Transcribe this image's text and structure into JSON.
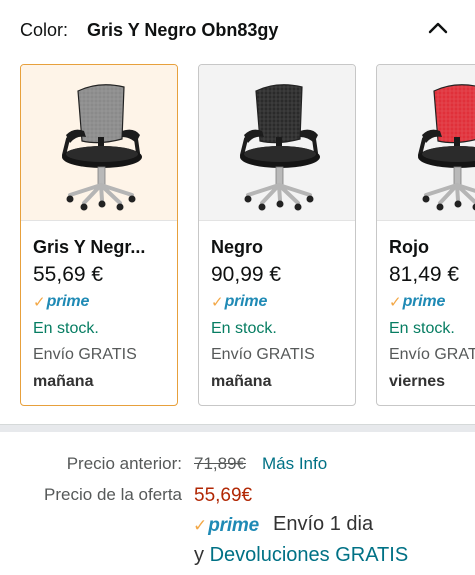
{
  "color_selector": {
    "label": "Color:",
    "selected_value": "Gris Y Negro Obn83gy",
    "collapse_icon": "chevron-up-icon"
  },
  "swatches": [
    {
      "name": "Gris Y Negr...",
      "price": "55,69 €",
      "prime": "prime",
      "stock": "En stock.",
      "shipping": "Envío GRATIS",
      "delivery_day": "mañana",
      "chair_color": "#8a8a8a",
      "selected": true
    },
    {
      "name": "Negro",
      "price": "90,99 €",
      "prime": "prime",
      "stock": "En stock.",
      "shipping": "Envío GRATIS",
      "delivery_day": "mañana",
      "chair_color": "#2a2a2a",
      "selected": false
    },
    {
      "name": "Rojo",
      "price": "81,49 €",
      "prime": "prime",
      "stock": "En stock.",
      "shipping": "Envío GRAT",
      "delivery_day": "viernes",
      "chair_color": "#e0303a",
      "selected": false
    }
  ],
  "pricing": {
    "previous_label": "Precio anterior:",
    "previous_price": "71,89€",
    "more_info": "Más Info",
    "offer_label": "Precio de la oferta",
    "offer_price": "55,69€",
    "prime": "prime",
    "shipping": "Envío 1 dia",
    "returns_prefix": "y",
    "returns_link": "Devoluciones GRATIS"
  },
  "colors": {
    "accent_selected_border": "#e7a03c",
    "stock_green": "#067d62",
    "link_teal": "#007185",
    "offer_red": "#b12704",
    "prime_blue": "#1f8ab5",
    "prime_orange": "#f3a847"
  }
}
